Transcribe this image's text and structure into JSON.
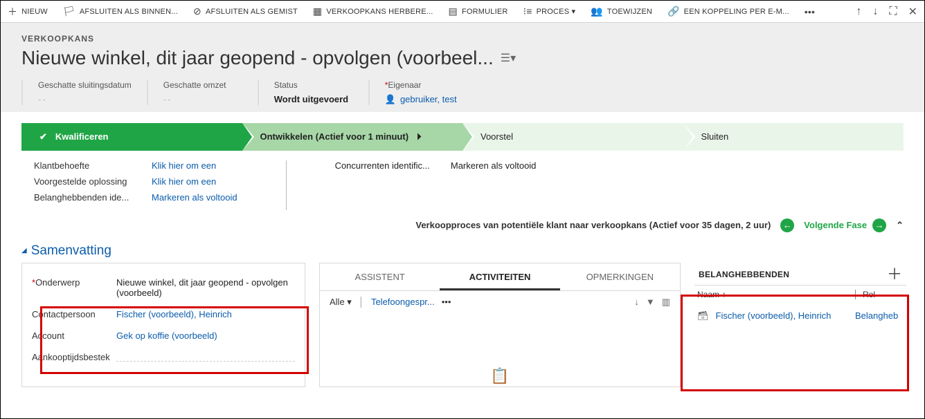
{
  "cmdbar": {
    "items": [
      {
        "glyph": "＋",
        "label": "NIEUW"
      },
      {
        "glyph": "🏳",
        "label": "AFSLUITEN ALS BINNEN..."
      },
      {
        "glyph": "⊘",
        "label": "AFSLUITEN ALS GEMIST"
      },
      {
        "glyph": "▦",
        "label": "VERKOOPKANS HERBERE..."
      },
      {
        "glyph": "▤",
        "label": "FORMULIER"
      },
      {
        "glyph": "⁝≡",
        "label": "PROCES ▾"
      },
      {
        "glyph": "👥",
        "label": "TOEWIJZEN"
      },
      {
        "glyph": "🔗",
        "label": "EEN KOPPELING PER E-M..."
      },
      {
        "glyph": "•••",
        "label": ""
      }
    ]
  },
  "header": {
    "entity": "VERKOOPKANS",
    "title": "Nieuwe winkel, dit jaar geopend - opvolgen (voorbeel...",
    "fields": {
      "close_date_label": "Geschatte sluitingsdatum",
      "close_date_value": "--",
      "revenue_label": "Geschatte omzet",
      "revenue_value": "--",
      "status_label": "Status",
      "status_value": "Wordt uitgevoerd",
      "owner_label": "Eigenaar",
      "owner_value": "gebruiker, test"
    }
  },
  "process": {
    "stages": [
      {
        "label": "Kwalificeren"
      },
      {
        "label": "Ontwikkelen (Actief voor 1 minuut)"
      },
      {
        "label": "Voorstel"
      },
      {
        "label": "Sluiten"
      }
    ],
    "left_rows": [
      {
        "label": "Klantbehoefte",
        "value": "Klik hier om een"
      },
      {
        "label": "Voorgestelde oplossing",
        "value": "Klik hier om een"
      },
      {
        "label": "Belanghebbenden ide...",
        "value": "Markeren als voltooid"
      }
    ],
    "right_rows": [
      {
        "label": "Concurrenten identific...",
        "value": "Markeren als voltooid"
      }
    ],
    "footer_text": "Verkoopproces van potentiële klant naar verkoopkans (Actief voor 35 dagen, 2 uur)",
    "next_label": "Volgende Fase"
  },
  "section_title": "Samenvatting",
  "left_panel": {
    "rows": [
      {
        "label": "Onderwerp",
        "req": true,
        "value": "Nieuwe winkel, dit jaar geopend - opvolgen (voorbeeld)",
        "link": false
      },
      {
        "label": "Contactpersoon",
        "value": "Fischer (voorbeeld), Heinrich",
        "link": true
      },
      {
        "label": "Account",
        "value": "Gek op koffie (voorbeeld)",
        "link": true
      },
      {
        "label": "Aankooptijdsbestek",
        "value": "",
        "dashed": true
      }
    ]
  },
  "middle_panel": {
    "tabs": [
      "ASSISTENT",
      "ACTIVITEITEN",
      "OPMERKINGEN"
    ],
    "filter_all": "Alle",
    "activity_link": "Telefoongespr..."
  },
  "right_panel": {
    "title": "BELANGHEBBENDEN",
    "col1": "Naam",
    "col2": "Rol",
    "row_name": "Fischer (voorbeeld), Heinrich",
    "row_rol": "Belangheb"
  }
}
